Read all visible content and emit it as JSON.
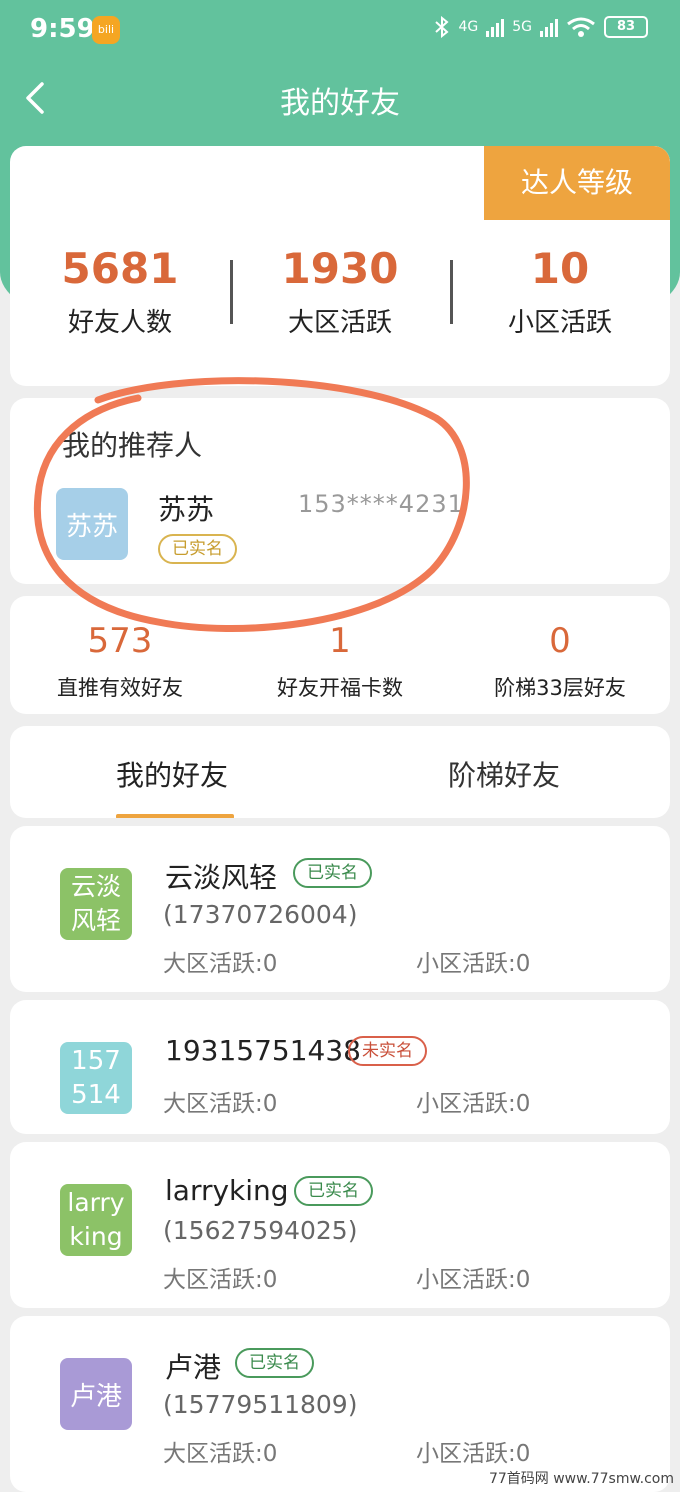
{
  "status": {
    "time": "9:59",
    "app_badge": "bili",
    "net1": "4G",
    "net2": "5G",
    "battery": "83"
  },
  "nav": {
    "title": "我的好友"
  },
  "summary": {
    "level_button": "达人等级",
    "stats": [
      {
        "value": "5681",
        "label": "好友人数"
      },
      {
        "value": "1930",
        "label": "大区活跃"
      },
      {
        "value": "10",
        "label": "小区活跃"
      }
    ]
  },
  "referrer": {
    "title": "我的推荐人",
    "avatar_text": "苏苏",
    "name": "苏苏",
    "phone": "153****4231",
    "badge": "已实名"
  },
  "stats2": [
    {
      "value": "573",
      "label": "直推有效好友"
    },
    {
      "value": "1",
      "label": "好友开福卡数"
    },
    {
      "value": "0",
      "label": "阶梯33层好友"
    }
  ],
  "tabs": {
    "active": "我的好友",
    "other": "阶梯好友"
  },
  "friends": [
    {
      "avatar_text": "云淡风轻",
      "name": "云淡风轻",
      "badge": "已实名",
      "phone": "(17370726004)",
      "big_zone": "大区活跃:0",
      "small_zone": "小区活跃:0"
    },
    {
      "avatar_text": "19315751438",
      "name": "19315751438",
      "badge": "未实名",
      "phone": "",
      "big_zone": "大区活跃:0",
      "small_zone": "小区活跃:0"
    },
    {
      "avatar_text": "larryking",
      "name": "larryking",
      "badge": "已实名",
      "phone": "(15627594025)",
      "big_zone": "大区活跃:0",
      "small_zone": "小区活跃:0"
    },
    {
      "avatar_text": "卢港",
      "name": "卢港",
      "badge": "已实名",
      "phone": "(15779511809)",
      "big_zone": "大区活跃:0",
      "small_zone": "小区活跃:0"
    }
  ],
  "watermark": "77首码网 www.77smw.com",
  "colors": {
    "header": "#62c29d",
    "accent": "#eea43f",
    "number": "#d9683a",
    "annotation": "#f07a55"
  }
}
